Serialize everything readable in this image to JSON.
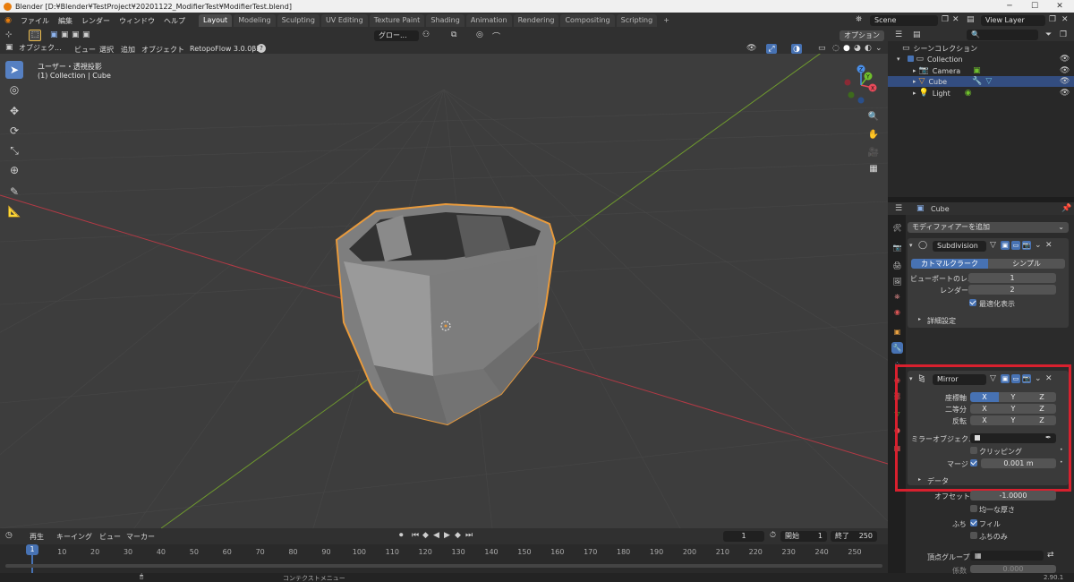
{
  "window": {
    "title": "Blender [D:¥Blender¥TestProject¥20201122_ModifierTest¥ModifierTest.blend]",
    "min": "─",
    "max": "☐",
    "close": "✕"
  },
  "menu": {
    "file": "ファイル",
    "edit": "編集",
    "render": "レンダー",
    "window": "ウィンドウ",
    "help": "ヘルプ"
  },
  "workspaces": [
    "Layout",
    "Modeling",
    "Sculpting",
    "UV Editing",
    "Texture Paint",
    "Shading",
    "Animation",
    "Rendering",
    "Compositing",
    "Scripting",
    "+"
  ],
  "scene": {
    "name": "Scene",
    "view_layer": "View Layer"
  },
  "viewport_header": {
    "mode": "オブジェク...",
    "view": "ビュー",
    "select": "選択",
    "add": "追加",
    "object": "オブジェクト",
    "addon": "RetopoFlow 3.0.0β2",
    "transform": "グロー...",
    "options": "オプション"
  },
  "viewport": {
    "view_name": "ユーザー・透視投影",
    "collection_info": "(1) Collection | Cube"
  },
  "gizmo": {
    "x": "X",
    "y": "Y",
    "z": "Z"
  },
  "timeline": {
    "playback": "再生",
    "keying": "キーイング",
    "view": "ビュー",
    "marker": "マーカー",
    "current_frame": "1",
    "start_label": "開始",
    "start": "1",
    "end_label": "終了",
    "end": "250",
    "ticks": [
      "1",
      "10",
      "20",
      "30",
      "40",
      "50",
      "60",
      "70",
      "80",
      "90",
      "100",
      "110",
      "120",
      "130",
      "140",
      "150",
      "160",
      "170",
      "180",
      "190",
      "200",
      "210",
      "220",
      "230",
      "240",
      "250"
    ]
  },
  "status": {
    "context_menu": "コンテクストメニュー",
    "version": "2.90.1"
  },
  "outliner": {
    "root": "シーンコレクション",
    "collection": "Collection",
    "items": [
      "Camera",
      "Cube",
      "Light"
    ]
  },
  "properties": {
    "object_name": "Cube",
    "add_modifier": "モディファイアーを追加",
    "subdivision": {
      "name": "Subdivision",
      "catmull": "カトマルクラーク",
      "simple": "シンプル",
      "viewport_label": "ビューポートのレ...",
      "viewport_value": "1",
      "render_label": "レンダー",
      "render_value": "2",
      "optimal": "最適化表示",
      "advanced": "詳細設定"
    },
    "mirror": {
      "name": "Mirror",
      "axis": "座標軸",
      "bisect": "二等分",
      "flip": "反転",
      "x": "X",
      "y": "Y",
      "z": "Z",
      "mirror_object": "ミラーオブジェク...",
      "clipping": "クリッピング",
      "merge": "マージ",
      "merge_value": "0.001 m",
      "data": "データ"
    },
    "solidify": {
      "offset": "オフセット",
      "offset_value": "-1.0000",
      "even": "均一な厚さ",
      "rim": "ふち",
      "fill": "フィル",
      "rim_only": "ふちのみ",
      "vgroup": "頂点グループ",
      "factor": "係数",
      "factor_value": "0.000"
    }
  },
  "colors": {
    "accent": "#4772b3",
    "selection": "#e89a3c",
    "highlight": "#d8202e"
  }
}
